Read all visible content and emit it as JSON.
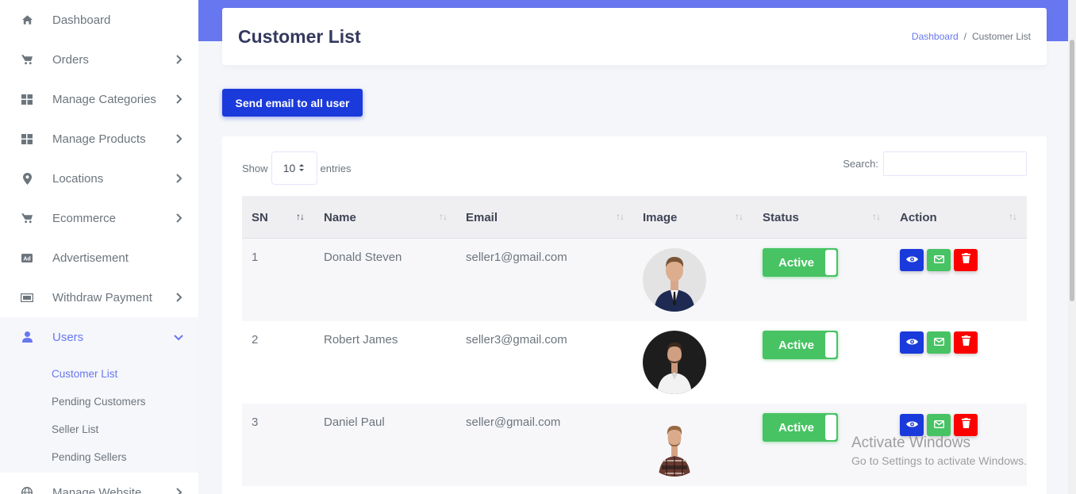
{
  "sidebar": {
    "items": [
      {
        "label": "Dashboard",
        "icon": "home-icon",
        "has_children": false
      },
      {
        "label": "Orders",
        "icon": "cart-icon",
        "has_children": true
      },
      {
        "label": "Manage Categories",
        "icon": "grid-icon",
        "has_children": true
      },
      {
        "label": "Manage Products",
        "icon": "grid-icon",
        "has_children": true
      },
      {
        "label": "Locations",
        "icon": "map-pin-icon",
        "has_children": true
      },
      {
        "label": "Ecommerce",
        "icon": "cart-icon",
        "has_children": true
      },
      {
        "label": "Advertisement",
        "icon": "ad-icon",
        "has_children": false
      },
      {
        "label": "Withdraw Payment",
        "icon": "money-icon",
        "has_children": true
      },
      {
        "label": "Users",
        "icon": "user-icon",
        "has_children": true,
        "active": true
      },
      {
        "label": "Manage Website",
        "icon": "globe-icon",
        "has_children": true
      }
    ],
    "users_submenu": [
      {
        "label": "Customer List",
        "active": true
      },
      {
        "label": "Pending Customers"
      },
      {
        "label": "Seller List"
      },
      {
        "label": "Pending Sellers"
      }
    ]
  },
  "header": {
    "title": "Customer List",
    "breadcrumb": {
      "link": "Dashboard",
      "separator": "/",
      "current": "Customer List"
    }
  },
  "send_email_button": "Send email to all user",
  "table_controls": {
    "show_label": "Show",
    "entries_value": "10",
    "entries_label": "entries",
    "search_label": "Search:",
    "search_value": ""
  },
  "table": {
    "columns": [
      "SN",
      "Name",
      "Email",
      "Image",
      "Status",
      "Action"
    ],
    "sort_indicator": "↑↓",
    "rows": [
      {
        "sn": "1",
        "name": "Donald Steven",
        "email": "seller1@gmail.com",
        "status": "Active"
      },
      {
        "sn": "2",
        "name": "Robert James",
        "email": "seller3@gmail.com",
        "status": "Active"
      },
      {
        "sn": "3",
        "name": "Daniel Paul",
        "email": "seller@gmail.com",
        "status": "Active"
      }
    ]
  },
  "watermark": {
    "line1": "Activate Windows",
    "line2": "Go to Settings to activate Windows."
  },
  "colors": {
    "primary": "#6777ef",
    "send_button": "#1a3adb",
    "success": "#47c363",
    "danger": "#fc0000"
  }
}
